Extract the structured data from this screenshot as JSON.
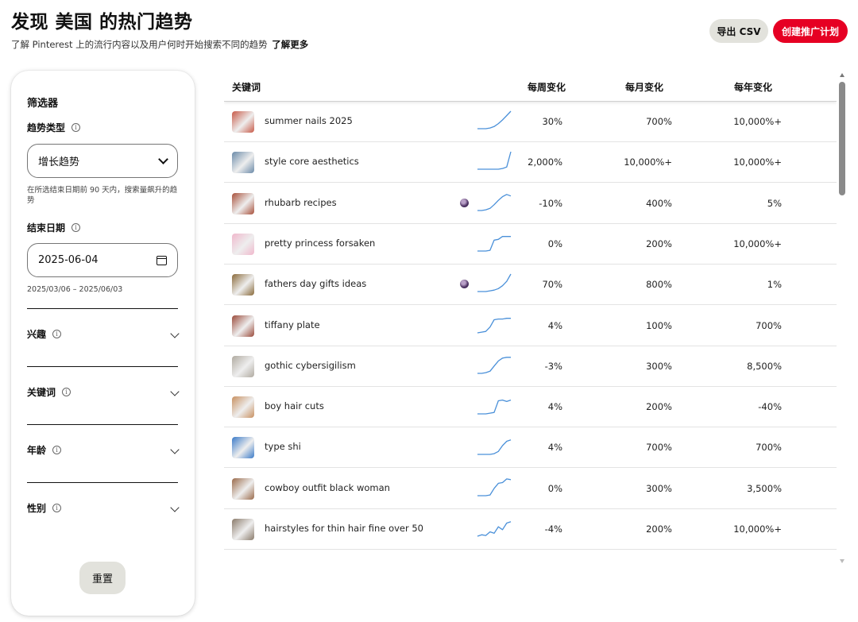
{
  "header": {
    "title": "发现 美国 的热门趋势",
    "subtitle": "了解 Pinterest 上的流行内容以及用户何时开始搜索不同的趋势",
    "learn_more": "了解更多"
  },
  "actions": {
    "export_label": "导出 CSV",
    "create_label": "创建推广计划",
    "create_color": "#e60023"
  },
  "filters": {
    "title": "筛选器",
    "trend_type": {
      "label": "趋势类型",
      "value": "增长趋势",
      "helper": "在所选结束日期前 90 天内，搜索量飙升的趋势"
    },
    "end_date": {
      "label": "结束日期",
      "value": "2025-06-04",
      "range": "2025/03/06 – 2025/06/03"
    },
    "sections": [
      {
        "label": "兴趣"
      },
      {
        "label": "关键词"
      },
      {
        "label": "年龄"
      },
      {
        "label": "性别"
      }
    ],
    "reset_label": "重置"
  },
  "table": {
    "columns": {
      "keyword": "关键词",
      "weekly": "每周变化",
      "monthly": "每月变化",
      "yearly": "每年变化"
    },
    "rows": [
      {
        "keyword": "summer nails 2025",
        "weekly": "30%",
        "monthly": "700%",
        "yearly": "10,000%+",
        "thumb": "#c85a48",
        "trend": [
          0,
          0,
          0,
          1,
          3,
          7,
          12,
          18,
          24
        ]
      },
      {
        "keyword": "style core aesthetics",
        "weekly": "2,000%",
        "monthly": "10,000%+",
        "yearly": "10,000%+",
        "thumb": "#6a8aa8",
        "trend": [
          0,
          0,
          0,
          0,
          0,
          0,
          1,
          3,
          24
        ]
      },
      {
        "keyword": "rhubarb recipes",
        "weekly": "-10%",
        "monthly": "400%",
        "yearly": "5%",
        "thumb": "#a8503a",
        "pin": true,
        "trend": [
          0,
          0,
          1,
          3,
          8,
          14,
          19,
          22,
          20
        ]
      },
      {
        "keyword": "pretty princess forsaken",
        "weekly": "0%",
        "monthly": "200%",
        "yearly": "10,000%+",
        "thumb": "#f0b8cc",
        "trend": [
          0,
          0,
          0,
          1,
          15,
          16,
          20,
          20,
          20
        ]
      },
      {
        "keyword": "fathers day gifts ideas",
        "weekly": "70%",
        "monthly": "800%",
        "yearly": "1%",
        "thumb": "#8a6a3a",
        "pin": true,
        "trend": [
          0,
          0,
          0,
          1,
          2,
          4,
          8,
          14,
          24
        ]
      },
      {
        "keyword": "tiffany plate",
        "weekly": "4%",
        "monthly": "100%",
        "yearly": "700%",
        "thumb": "#9a4a3a",
        "trend": [
          0,
          1,
          2,
          8,
          18,
          19,
          19,
          20,
          20
        ]
      },
      {
        "keyword": "gothic cybersigilism",
        "weekly": "-3%",
        "monthly": "300%",
        "yearly": "8,500%",
        "thumb": "#b0aaa0",
        "trend": [
          0,
          0,
          1,
          3,
          10,
          17,
          21,
          22,
          22
        ]
      },
      {
        "keyword": "boy hair cuts",
        "weekly": "4%",
        "monthly": "200%",
        "yearly": "-40%",
        "thumb": "#c89060",
        "trend": [
          0,
          0,
          0,
          1,
          2,
          18,
          19,
          17,
          19
        ]
      },
      {
        "keyword": "type shi",
        "weekly": "4%",
        "monthly": "700%",
        "yearly": "700%",
        "thumb": "#3a7ac8",
        "trend": [
          0,
          0,
          0,
          0,
          1,
          4,
          12,
          18,
          20
        ]
      },
      {
        "keyword": "cowboy outfit black woman",
        "weekly": "0%",
        "monthly": "300%",
        "yearly": "3,500%",
        "thumb": "#9a6a4a",
        "trend": [
          0,
          0,
          0,
          1,
          10,
          17,
          18,
          23,
          22
        ]
      },
      {
        "keyword": "hairstyles for thin hair fine over 50",
        "weekly": "-4%",
        "monthly": "200%",
        "yearly": "10,000%+",
        "thumb": "#8a7a6a",
        "trend": [
          0,
          2,
          1,
          6,
          4,
          13,
          9,
          18,
          20
        ]
      }
    ]
  }
}
